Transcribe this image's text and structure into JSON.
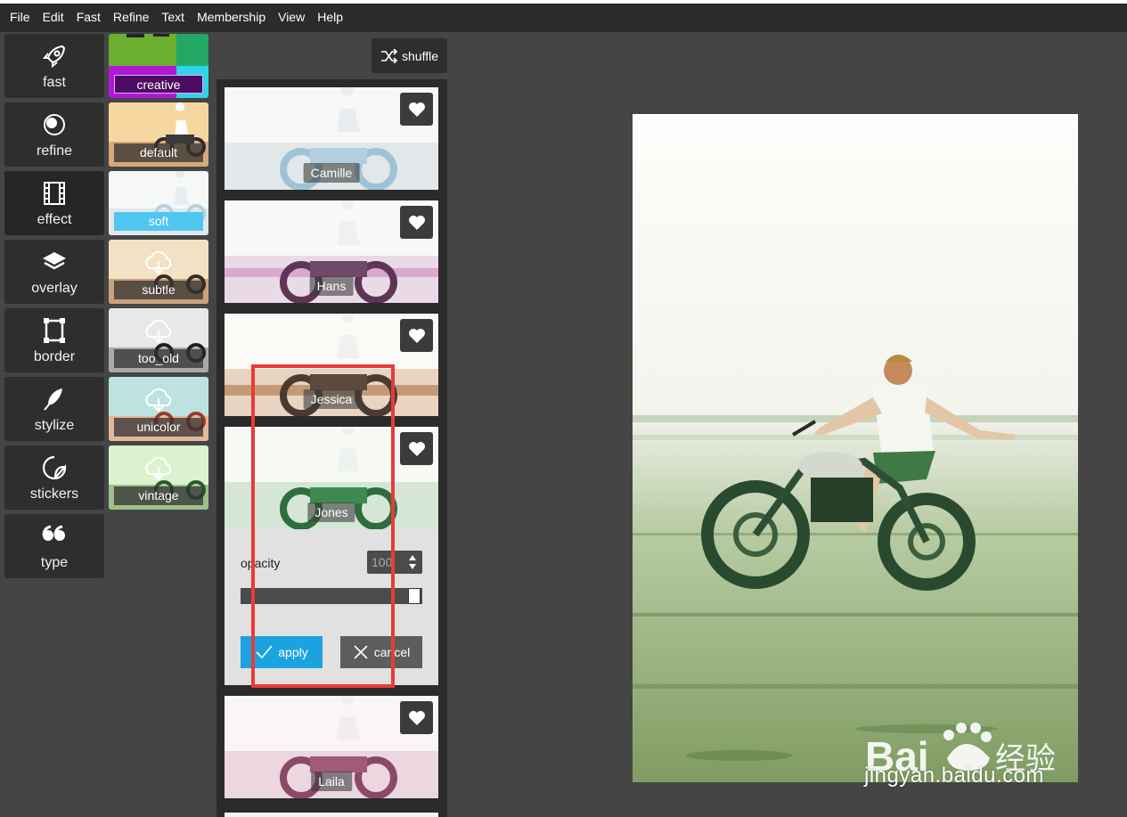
{
  "menu": [
    "File",
    "Edit",
    "Fast",
    "Refine",
    "Text",
    "Membership",
    "View",
    "Help"
  ],
  "tools": [
    {
      "label": "fast",
      "icon": "rocket-icon"
    },
    {
      "label": "refine",
      "icon": "circles-icon"
    },
    {
      "label": "effect",
      "icon": "film-icon"
    },
    {
      "label": "overlay",
      "icon": "layers-icon"
    },
    {
      "label": "border",
      "icon": "frame-icon"
    },
    {
      "label": "stylize",
      "icon": "feather-icon"
    },
    {
      "label": "stickers",
      "icon": "sticker-icon"
    },
    {
      "label": "type",
      "icon": "quote-icon"
    }
  ],
  "active_tool": "effect",
  "categories": [
    {
      "label": "creative"
    },
    {
      "label": "default"
    },
    {
      "label": "soft"
    },
    {
      "label": "subtle"
    },
    {
      "label": "too_old"
    },
    {
      "label": "unicolor"
    },
    {
      "label": "vintage"
    }
  ],
  "active_category": "soft",
  "shuffle_label": "shuffle",
  "effects": [
    {
      "label": "Camille",
      "tint": "#9fc3d6"
    },
    {
      "label": "Hans",
      "tint": "#c06fb0"
    },
    {
      "label": "Jessica",
      "tint": "#b88a6a"
    },
    {
      "label": "Jones",
      "tint": "#3f8a50"
    },
    {
      "label": "Laila",
      "tint": "#c98aa8"
    }
  ],
  "opacity": {
    "label": "opacity",
    "value": "100",
    "fraction": 1.0
  },
  "apply_label": "apply",
  "cancel_label": "cancel",
  "watermark": {
    "brand": "Bai",
    "brand2": "经验",
    "url": "jingyan.baidu.com"
  }
}
